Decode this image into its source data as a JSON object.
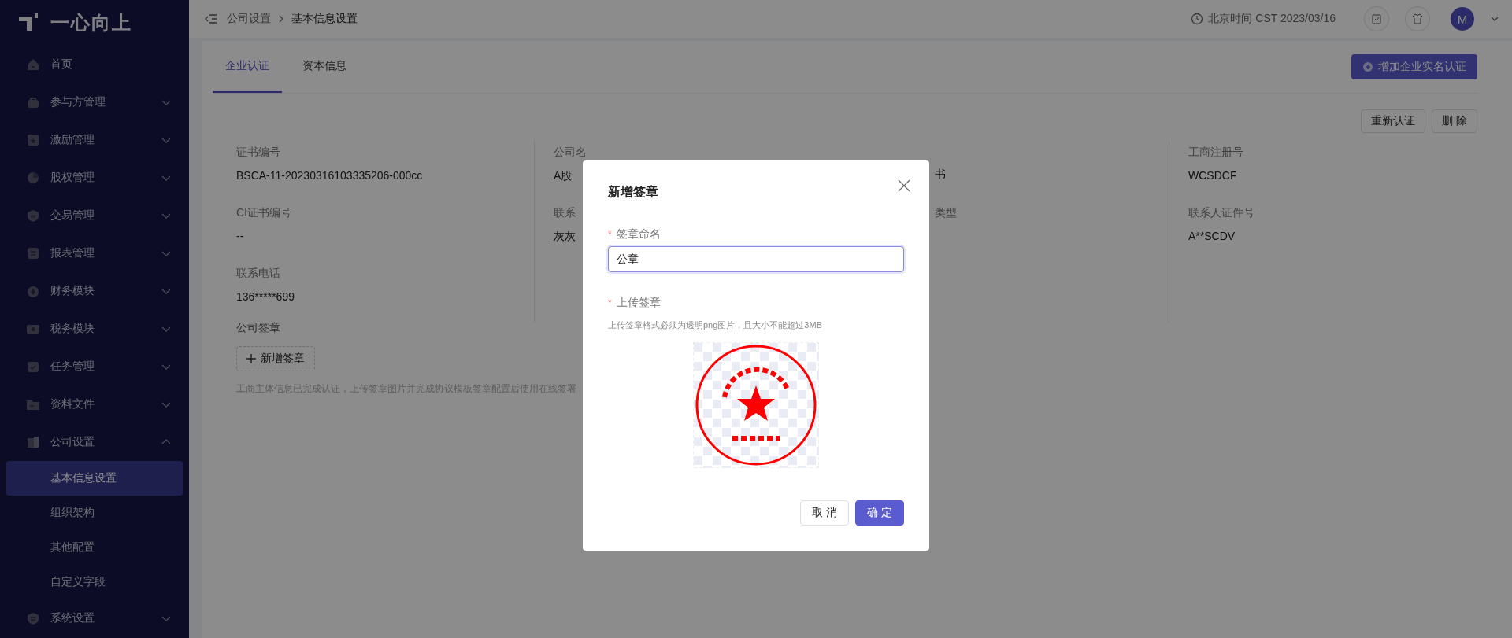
{
  "logo": {
    "text": "一心向上"
  },
  "sidebar": {
    "items": [
      {
        "label": "首页",
        "kind": "link"
      },
      {
        "label": "参与方管理",
        "kind": "group",
        "expanded": false
      },
      {
        "label": "激励管理",
        "kind": "group",
        "expanded": false
      },
      {
        "label": "股权管理",
        "kind": "group",
        "expanded": false
      },
      {
        "label": "交易管理",
        "kind": "group",
        "expanded": false
      },
      {
        "label": "报表管理",
        "kind": "group",
        "expanded": false
      },
      {
        "label": "财务模块",
        "kind": "group",
        "expanded": false
      },
      {
        "label": "税务模块",
        "kind": "group",
        "expanded": false
      },
      {
        "label": "任务管理",
        "kind": "group",
        "expanded": false
      },
      {
        "label": "资料文件",
        "kind": "group",
        "expanded": false
      },
      {
        "label": "公司设置",
        "kind": "group",
        "expanded": true,
        "children": [
          {
            "label": "基本信息设置",
            "selected": true
          },
          {
            "label": "组织架构",
            "selected": false
          },
          {
            "label": "其他配置",
            "selected": false
          },
          {
            "label": "自定义字段",
            "selected": false
          }
        ]
      },
      {
        "label": "系统设置",
        "kind": "group",
        "expanded": false
      }
    ]
  },
  "header": {
    "breadcrumb": [
      "公司设置",
      "基本信息设置"
    ],
    "clock": "北京时间 CST 2023/03/16",
    "avatar": "M"
  },
  "tabs": [
    {
      "label": "企业认证",
      "selected": true
    },
    {
      "label": "资本信息",
      "selected": false
    }
  ],
  "add_button": "增加企业实名认证",
  "actions": [
    "重新认证",
    "删 除"
  ],
  "field_columns": [
    [
      {
        "label": "证书编号",
        "value": "BSCA-11-20230316103335206-000cc"
      },
      {
        "label": "CI证书编号",
        "value": "--"
      },
      {
        "label": "联系电话",
        "value": "136*****699"
      }
    ],
    [
      {
        "label": "公司名",
        "value": "A股"
      },
      {
        "label": "联系",
        "value": "灰灰"
      }
    ],
    [
      {
        "value": "书"
      },
      {
        "label": "类型"
      }
    ],
    [
      {
        "label": "工商注册号",
        "value": "WCSDCF"
      },
      {
        "label": "联系人证件号",
        "value": "A**SCDV"
      }
    ]
  ],
  "seal_section": {
    "title": "公司签章",
    "add_button": "新增签章",
    "note": "工商主体信息已完成认证，上传签章图片并完成协议模板签章配置后使用在线签署"
  },
  "dialog": {
    "title": "新增签章",
    "name_mark": "*",
    "name_label": "签章命名",
    "name_value": "公章",
    "upload_mark": "*",
    "upload_label": "上传签章",
    "upload_hint": "上传签章格式必须为透明png图片，且大小不能超过3MB",
    "buttons": [
      {
        "label": "取 消",
        "kind": "default"
      },
      {
        "label": "确 定",
        "kind": "primary"
      }
    ]
  }
}
